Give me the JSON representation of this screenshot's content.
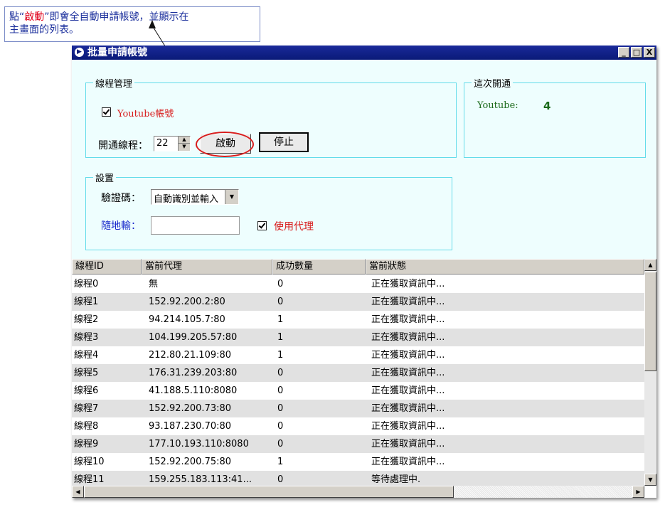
{
  "callout": {
    "pre": "點“",
    "highlight": "啟動",
    "post": "”即會全自動申請帳號，並顯示在",
    "line2": "主畫面的列表。"
  },
  "window": {
    "title": "批量申請帳號",
    "min": "_",
    "max": "□",
    "close": "X"
  },
  "thread_group": {
    "legend": "線程管理",
    "checkbox_label": "Youtube帳號",
    "thread_label": "開通線程：",
    "thread_value": "22",
    "start_button": "啟動",
    "stop_button": "停止"
  },
  "result_group": {
    "legend": "這次開通",
    "service": "Youtube:",
    "count": "4"
  },
  "settings_group": {
    "legend": "設置",
    "captcha_label": "驗證碼：",
    "captcha_value": "自動識別並輸入",
    "input_label": "隨地輸：",
    "input_value": "",
    "proxy_label": "使用代理"
  },
  "table": {
    "columns": [
      "線程ID",
      "當前代理",
      "成功數量",
      "當前狀態"
    ],
    "rows": [
      [
        "線程0",
        "無",
        "0",
        "正在獲取資訊中..."
      ],
      [
        "線程1",
        "152.92.200.2:80",
        "0",
        "正在獲取資訊中..."
      ],
      [
        "線程2",
        "94.214.105.7:80",
        "1",
        "正在獲取資訊中..."
      ],
      [
        "線程3",
        "104.199.205.57:80",
        "1",
        "正在獲取資訊中..."
      ],
      [
        "線程4",
        "212.80.21.109:80",
        "1",
        "正在獲取資訊中..."
      ],
      [
        "線程5",
        "176.31.239.203:80",
        "0",
        "正在獲取資訊中..."
      ],
      [
        "線程6",
        "41.188.5.110:8080",
        "0",
        "正在獲取資訊中..."
      ],
      [
        "線程7",
        "152.92.200.73:80",
        "0",
        "正在獲取資訊中..."
      ],
      [
        "線程8",
        "93.187.230.70:80",
        "0",
        "正在獲取資訊中..."
      ],
      [
        "線程9",
        "177.10.193.110:8080",
        "0",
        "正在獲取資訊中..."
      ],
      [
        "線程10",
        "152.92.200.75:80",
        "1",
        "正在獲取資訊中..."
      ],
      [
        "線程11",
        "159.255.183.113:41...",
        "0",
        "等待處理中."
      ]
    ]
  },
  "colors": {
    "title_bar": "#0a1a78",
    "panel_bg": "#eefefe",
    "group_border": "#63dcea",
    "youtube_label": "#d81c1c",
    "proxy_label": "#d81c1c",
    "input_label": "#1a2acc",
    "result_service": "#1a6a1a",
    "result_count": "#1a6a1a",
    "callout_text": "#1b2f9c",
    "callout_highlight": "#e0001a"
  }
}
